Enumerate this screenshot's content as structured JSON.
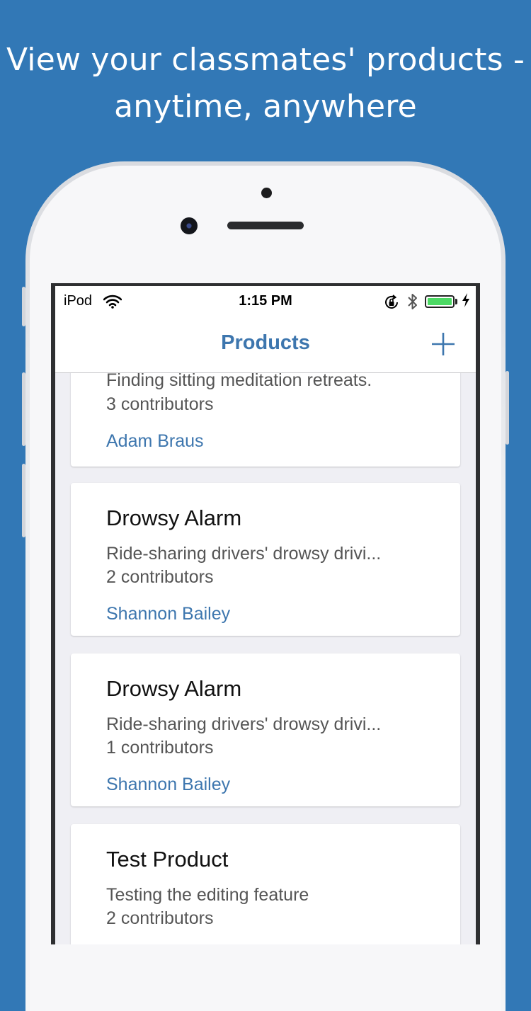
{
  "headline": {
    "line1": "View your classmates' products -",
    "line2": "anytime, anywhere"
  },
  "status_bar": {
    "carrier": "iPod",
    "time": "1:15 PM",
    "battery_level": 1.0,
    "icons": [
      "wifi-icon",
      "rotation-lock-icon",
      "bluetooth-icon",
      "battery-icon",
      "charging-bolt-icon"
    ]
  },
  "nav": {
    "title": "Products",
    "add_icon": "plus-icon"
  },
  "products": [
    {
      "title": "",
      "description": "Finding sitting meditation retreats.",
      "contributors": "3 contributors",
      "author": "Adam Braus"
    },
    {
      "title": "Drowsy Alarm",
      "description": "Ride-sharing drivers' drowsy drivi...",
      "contributors": "2 contributors",
      "author": "Shannon Bailey"
    },
    {
      "title": "Drowsy Alarm",
      "description": "Ride-sharing drivers' drowsy drivi...",
      "contributors": "1 contributors",
      "author": "Shannon Bailey"
    },
    {
      "title": "Test Product",
      "description": "Testing the editing feature",
      "contributors": "2 contributors",
      "author": ""
    }
  ],
  "colors": {
    "background": "#3278b6",
    "accent": "#3d76ae",
    "list_background": "#efeff4",
    "battery_fill": "#4cd964"
  }
}
